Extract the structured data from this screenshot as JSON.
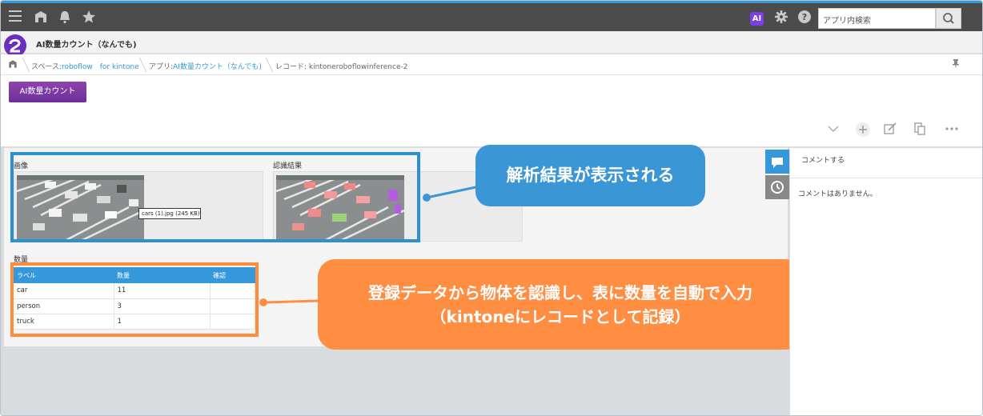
{
  "topbar": {
    "icons": [
      "menu-icon",
      "home-icon",
      "bell-icon",
      "star-icon"
    ],
    "ai_label": "AI",
    "search_placeholder": "アプリ内検索"
  },
  "app": {
    "title": "AI数量カウント（なんでも)"
  },
  "breadcrumb": {
    "space_prefix": "スペース:",
    "space_name": "roboflow　for kintone",
    "app_prefix": "アプリ:",
    "app_name": "AI数量カウント（なんでも)",
    "record": "レコード: kintoneroboflowinference-2"
  },
  "action_button": "AI数量カウント",
  "fields": {
    "image_label": "画像",
    "result_label": "認識結果",
    "tooltip": "cars (1).jpg (245 KB)",
    "quantity_label": "数量"
  },
  "table": {
    "headers": [
      "ラベル",
      "数量",
      "確認"
    ],
    "rows": [
      {
        "label": "car",
        "count": "11",
        "check": ""
      },
      {
        "label": "person",
        "count": "3",
        "check": ""
      },
      {
        "label": "truck",
        "count": "1",
        "check": ""
      }
    ]
  },
  "side": {
    "comment_placeholder": "コメントする",
    "no_comments": "コメントはありません。"
  },
  "callouts": {
    "blue": "解析結果が表示される",
    "orange_line1": "登録データから物体を認識し、表に数量を自動で入力",
    "orange_line2": "（kintoneにレコードとして記録）"
  },
  "colors": {
    "accent_blue": "#3498db",
    "callout_blue": "#3a96d5",
    "callout_orange": "#ff8e43",
    "button_purple": "#7d3aa8"
  }
}
